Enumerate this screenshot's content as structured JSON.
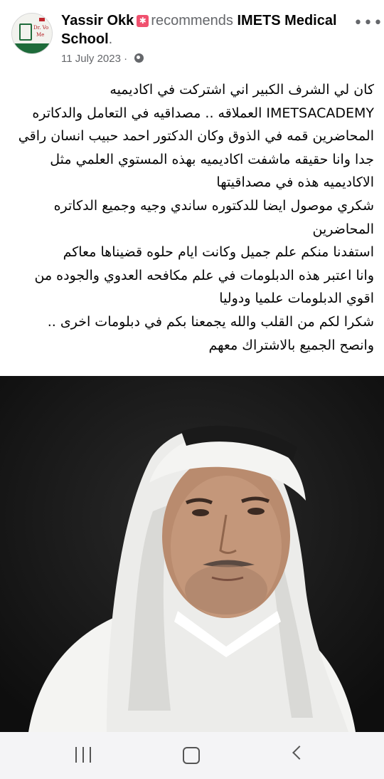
{
  "post": {
    "author": "Yassir Okk",
    "verb": "recommends",
    "page_name": "IMETS Medical School",
    "date": "11 July 2023",
    "more_label": "•••",
    "text_lines": [
      "كان لي الشرف الكبير اني اشتركت في اكاديميه",
      "IMETSACADEMY العملاقه .. مصداقيه في التعامل والدكاتره",
      "المحاضرين قمه في الذوق وكان الدكتور احمد حبيب انسان راقي",
      "جدا وانا حقيقه ماشفت اكاديميه بهذه المستوي العلمي مثل",
      "الاكاديميه هذه في مصداقيتها",
      "شكري موصول ايضا للدكتوره ساندي وجيه وجميع الدكاتره",
      "المحاضرين",
      "استفدنا منكم علم جميل وكانت ايام حلوه قضيناها معاكم",
      "وانا اعتبر هذه الدبلومات في علم مكافحه العدوي والجوده  من",
      "اقوي الدبلومات علميا ودوليا",
      "شكرا لكم من القلب والله يجمعنا بكم في دبلومات اخرى ..",
      "وانصح الجميع بالاشتراك معهم"
    ]
  },
  "avatar": {
    "text_top": "Dr. Vo",
    "text_mid": "Me"
  },
  "icons": {
    "recommend_badge": "recommend-badge-icon",
    "privacy": "globe-icon",
    "more": "more-options-icon",
    "nav_recent": "recent-apps-icon",
    "nav_home": "home-icon",
    "nav_back": "back-icon"
  },
  "colors": {
    "text": "#050505",
    "secondary": "#65676b",
    "badge": "#f0506e",
    "logo_green": "#1e6b3a",
    "logo_red": "#c0262d",
    "photo_bg": "#161616",
    "navbar_bg": "#f4f4f6"
  }
}
